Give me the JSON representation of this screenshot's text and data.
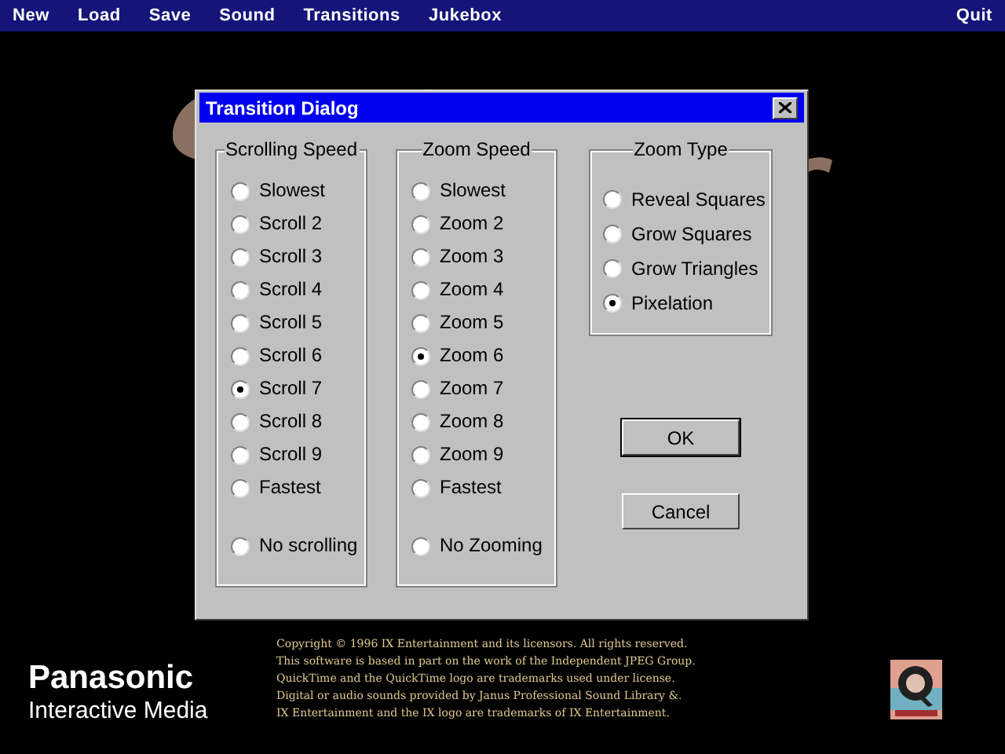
{
  "menu_bar": {
    "left": [
      "New",
      "Load",
      "Save",
      "Sound",
      "Transitions",
      "Jukebox"
    ],
    "right": [
      "Quit"
    ]
  },
  "dialog": {
    "title": "Transition Dialog",
    "groups": [
      {
        "title": "Scrolling Speed",
        "options": [
          {
            "label": "Slowest",
            "selected": false
          },
          {
            "label": "Scroll 2",
            "selected": false
          },
          {
            "label": "Scroll 3",
            "selected": false
          },
          {
            "label": "Scroll 4",
            "selected": false
          },
          {
            "label": "Scroll 5",
            "selected": false
          },
          {
            "label": "Scroll 6",
            "selected": false
          },
          {
            "label": "Scroll 7",
            "selected": true
          },
          {
            "label": "Scroll 8",
            "selected": false
          },
          {
            "label": "Scroll 9",
            "selected": false
          },
          {
            "label": "Fastest",
            "selected": false
          }
        ],
        "off_option": {
          "label": "No scrolling",
          "selected": false
        }
      },
      {
        "title": "Zoom Speed",
        "options": [
          {
            "label": "Slowest",
            "selected": false
          },
          {
            "label": "Zoom 2",
            "selected": false
          },
          {
            "label": "Zoom 3",
            "selected": false
          },
          {
            "label": "Zoom 4",
            "selected": false
          },
          {
            "label": "Zoom 5",
            "selected": false
          },
          {
            "label": "Zoom 6",
            "selected": true
          },
          {
            "label": "Zoom 7",
            "selected": false
          },
          {
            "label": "Zoom 8",
            "selected": false
          },
          {
            "label": "Zoom 9",
            "selected": false
          },
          {
            "label": "Fastest",
            "selected": false
          }
        ],
        "off_option": {
          "label": "No Zooming",
          "selected": false
        }
      }
    ],
    "zoom_type": {
      "title": "Zoom Type",
      "options": [
        {
          "label": "Reveal Squares",
          "selected": false
        },
        {
          "label": "Grow Squares",
          "selected": false
        },
        {
          "label": "Grow Triangles",
          "selected": false
        },
        {
          "label": "Pixelation",
          "selected": true
        }
      ]
    },
    "buttons": [
      {
        "label": "OK",
        "default": true
      },
      {
        "label": "Cancel",
        "default": false
      }
    ]
  },
  "publisher": {
    "name": "Panasonic",
    "subtitle": "Interactive Media"
  },
  "copyright": [
    "Copyright © 1996 IX Entertainment and its licensors. All rights reserved.",
    "This software is based in part on the work of the Independent JPEG Group.",
    "QuickTime and the QuickTime logo are trademarks used under license.",
    "Digital or audio sounds provided by Janus Professional Sound Library &.",
    "IX Entertainment and the IX logo are trademarks of IX Entertainment."
  ]
}
